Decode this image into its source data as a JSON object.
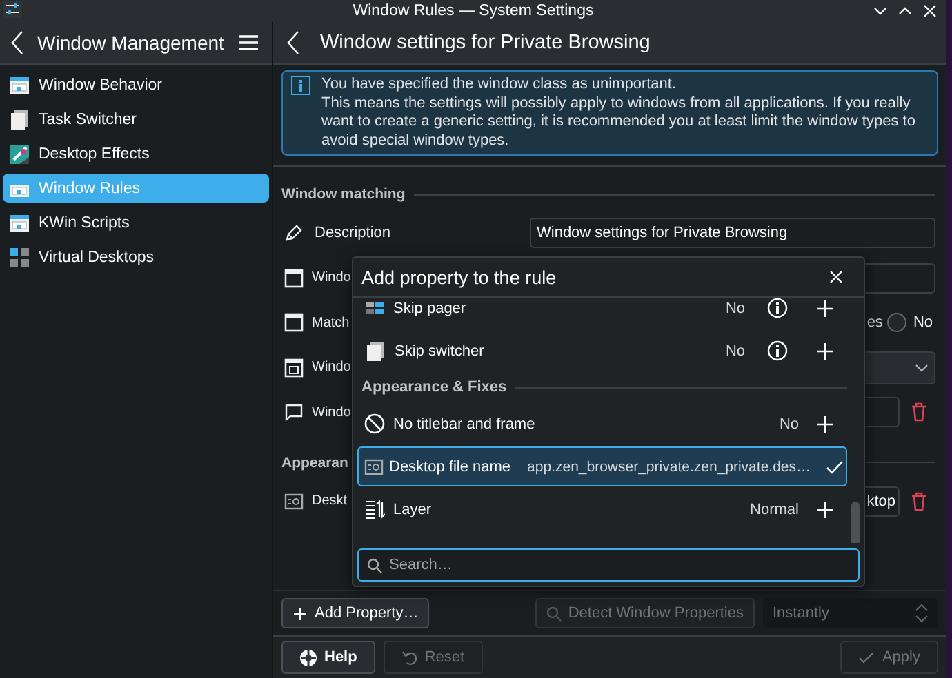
{
  "window": {
    "title": "Window Rules — System Settings"
  },
  "sidebar": {
    "title": "Window Management",
    "items": [
      {
        "label": "Window Behavior",
        "selected": false
      },
      {
        "label": "Task Switcher",
        "selected": false
      },
      {
        "label": "Desktop Effects",
        "selected": false
      },
      {
        "label": "Window Rules",
        "selected": true
      },
      {
        "label": "KWin Scripts",
        "selected": false
      },
      {
        "label": "Virtual Desktops",
        "selected": false
      }
    ]
  },
  "page": {
    "title": "Window settings for Private Browsing",
    "info": [
      "You have specified the window class as unimportant.",
      "This means the settings will possibly apply to windows from all applications. If you really want to create a generic setting, it is recommended you at least limit the window types to avoid special window types."
    ],
    "sections": [
      {
        "title": "Window matching",
        "rows": [
          {
            "kind": "text",
            "label": "Description",
            "value": "Window settings for Private Browsing"
          },
          {
            "kind": "pair",
            "label": "Windo"
          },
          {
            "kind": "radio",
            "label": "Match",
            "option_text": "es",
            "radio_label": "No",
            "selected": false
          },
          {
            "kind": "combo",
            "label": "Windo"
          },
          {
            "kind": "trash",
            "label": "Windo"
          }
        ]
      },
      {
        "title": "Appearan",
        "rows": [
          {
            "kind": "trash",
            "label": "Deskt",
            "value": "ktop"
          }
        ]
      }
    ],
    "add_property": "Add Property…",
    "detect": {
      "label": "Detect Window Properties",
      "disabled": true
    },
    "delay": {
      "value": "Instantly",
      "disabled": true
    }
  },
  "footer": [
    {
      "label": "Help",
      "disabled": false
    },
    {
      "label": "Reset",
      "disabled": true
    },
    {
      "label": "Apply",
      "disabled": true
    }
  ],
  "dialog": {
    "title": "Add property to the rule",
    "rows": [
      {
        "kind": "property",
        "label": "Skip pager",
        "value": "No",
        "info": true,
        "added": false,
        "selected": false
      },
      {
        "kind": "property",
        "label": "Skip switcher",
        "value": "No",
        "info": true,
        "added": false,
        "selected": false
      },
      {
        "kind": "heading",
        "label": "Appearance & Fixes"
      },
      {
        "kind": "property",
        "label": "No titlebar and frame",
        "value": "No",
        "info": false,
        "added": false,
        "selected": false
      },
      {
        "kind": "property",
        "label": "Desktop file name",
        "value": "app.zen_browser_private.zen_private.des…",
        "info": false,
        "added": true,
        "selected": true
      },
      {
        "kind": "property",
        "label": "Layer",
        "value": "Normal",
        "info": false,
        "added": false,
        "selected": false
      }
    ],
    "search": {
      "placeholder": "Search…"
    }
  }
}
